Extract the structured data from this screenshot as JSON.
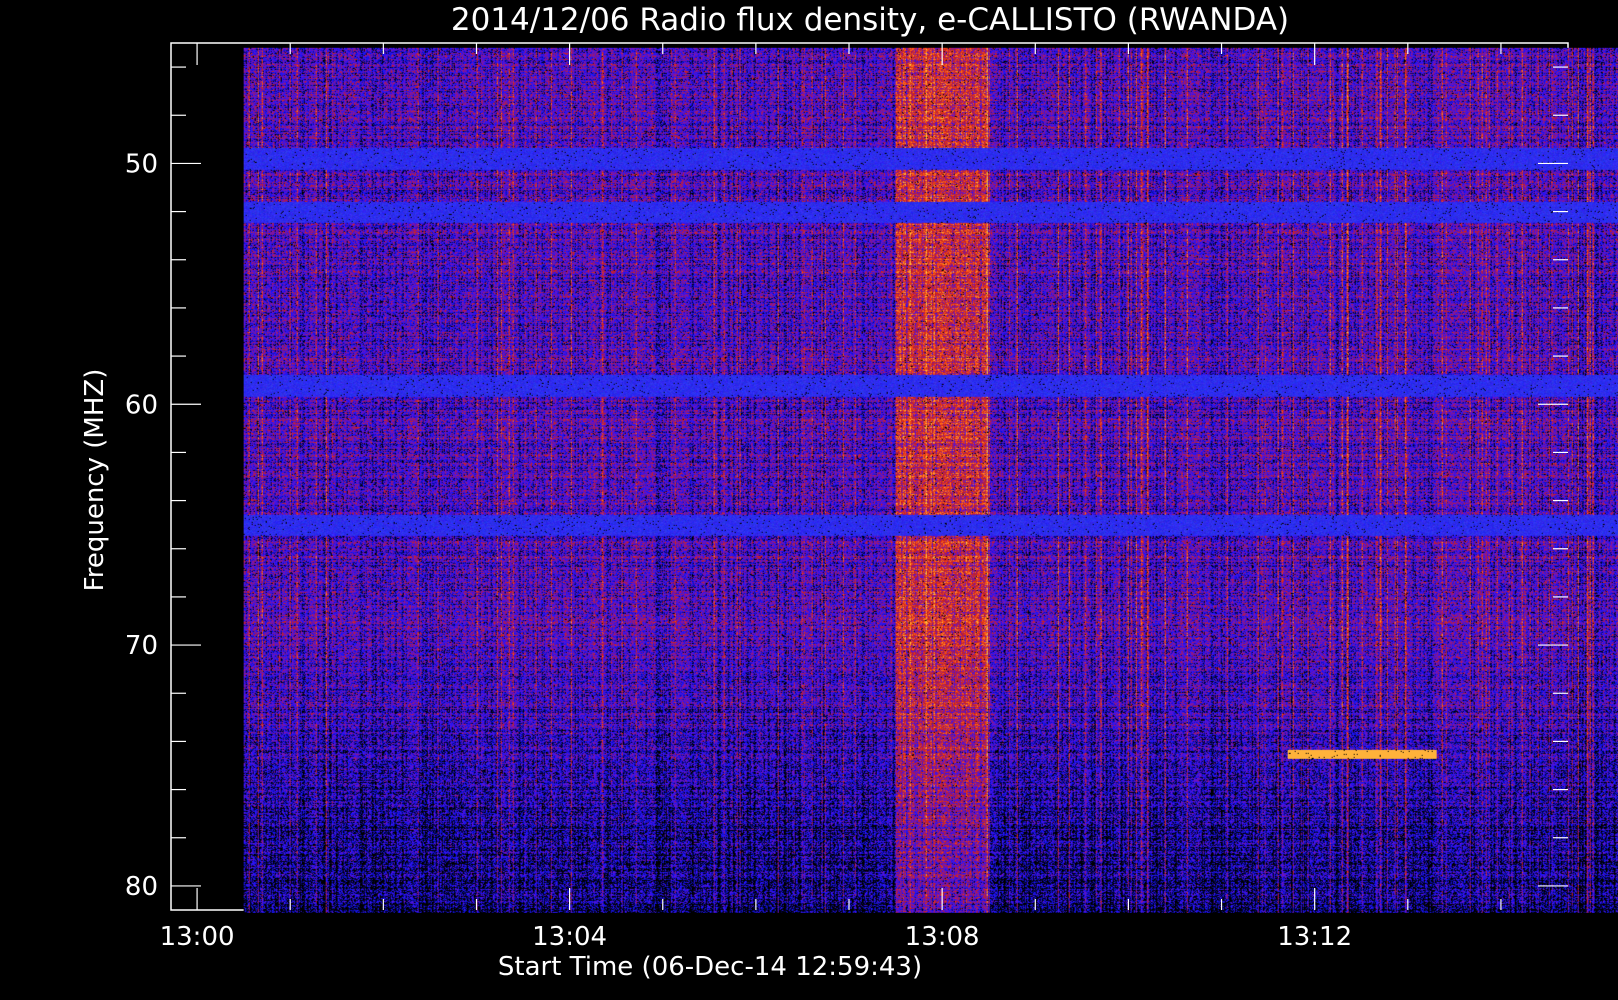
{
  "chart_data": {
    "type": "heatmap",
    "title": "2014/12/06  Radio flux density, e-CALLISTO (RWANDA)",
    "xlabel": "Start Time (06-Dec-14 12:59:43)",
    "ylabel": "Frequency (MHZ)",
    "x_range_min": [
      -0.28,
      14.72
    ],
    "y_range_mhz": [
      45,
      81
    ],
    "y_inverted": true,
    "data_extent": {
      "x_min": [
        0.5,
        15.5
      ],
      "y_mhz": [
        45.2,
        81.1
      ]
    },
    "x_ticks": [
      {
        "value_min": 0,
        "label": "13:00"
      },
      {
        "value_min": 4,
        "label": "13:04"
      },
      {
        "value_min": 8,
        "label": "13:08"
      },
      {
        "value_min": 12,
        "label": "13:12"
      }
    ],
    "y_ticks": [
      {
        "value": 50,
        "label": "50"
      },
      {
        "value": 60,
        "label": "60"
      },
      {
        "value": 70,
        "label": "70"
      },
      {
        "value": 80,
        "label": "80"
      }
    ],
    "colormap": [
      "#000000",
      "#1414ff",
      "#6a12c8",
      "#c81e1e",
      "#ff5a14",
      "#ffd046"
    ],
    "background": "#000000",
    "features": [
      {
        "kind": "broadband enhancement",
        "start_min": 7.5,
        "end_min": 8.5,
        "freq_mhz": [
          45,
          81
        ]
      },
      {
        "kind": "narrowband signal",
        "start_min": 11.7,
        "end_min": 13.3,
        "freq_mhz": 74.5
      },
      {
        "kind": "blue interference band",
        "freq_mhz": 65.0
      },
      {
        "kind": "blue interference band",
        "freq_mhz": 59.2
      },
      {
        "kind": "blue interference band",
        "freq_mhz": 52.0
      },
      {
        "kind": "blue interference band",
        "freq_mhz": 49.8
      }
    ]
  }
}
